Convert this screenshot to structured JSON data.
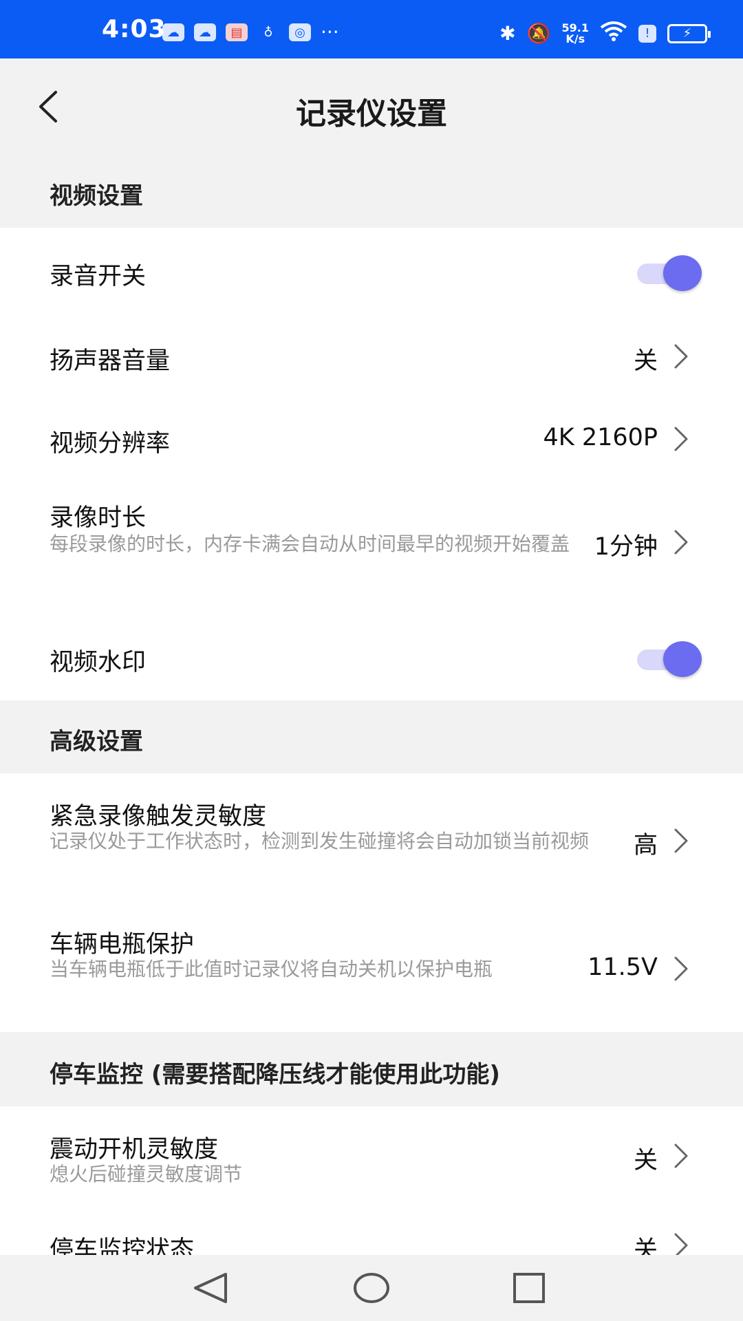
{
  "status_bar": {
    "time": "4:03",
    "network_speed_value": "59.1",
    "network_speed_unit": "K/s",
    "dots": "···",
    "icons": [
      "cloud-icon",
      "cloud-icon",
      "calendar-icon",
      "bulb-icon",
      "globe-icon",
      "bluetooth-icon",
      "bell-muted-icon",
      "wifi-icon",
      "alert-icon",
      "battery-charging-icon"
    ]
  },
  "header": {
    "title": "记录仪设置"
  },
  "sections": {
    "video": {
      "title": "视频设置",
      "items": [
        {
          "title": "录音开关",
          "type": "toggle",
          "on": true
        },
        {
          "title": "扬声器音量",
          "value": "关"
        },
        {
          "title": "视频分辨率",
          "value": "4K 2160P"
        },
        {
          "title": "录像时长",
          "desc": "每段录像的时长，内存卡满会自动从时间最早的视频开始覆盖",
          "value": "1分钟"
        },
        {
          "title": "视频水印",
          "type": "toggle",
          "on": true
        }
      ]
    },
    "advanced": {
      "title": "高级设置",
      "items": [
        {
          "title": "紧急录像触发灵敏度",
          "desc": "记录仪处于工作状态时，检测到发生碰撞将会自动加锁当前视频",
          "value": "高"
        },
        {
          "title": "车辆电瓶保护",
          "desc": "当车辆电瓶低于此值时记录仪将自动关机以保护电瓶",
          "value": "11.5V"
        }
      ]
    },
    "parking": {
      "title": "停车监控 (需要搭配降压线才能使用此功能)",
      "items": [
        {
          "title": "震动开机灵敏度",
          "desc": "熄火后碰撞灵敏度调节",
          "value": "关"
        },
        {
          "title": "停车监控状态",
          "value": "关"
        }
      ]
    }
  },
  "colors": {
    "status_bar": "#0b5cf5",
    "toggle_thumb": "#6b6cf0",
    "toggle_track": "#d9d7fa",
    "section_bg": "#f2f2f2"
  }
}
